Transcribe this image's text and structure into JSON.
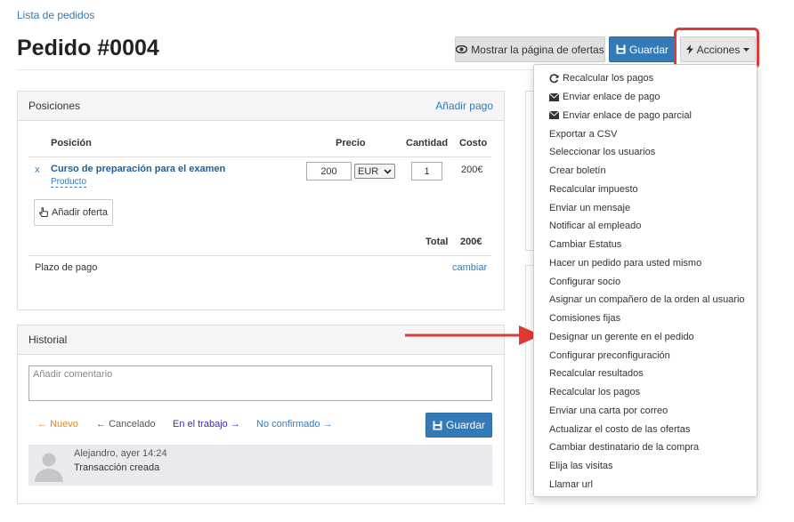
{
  "breadcrumb": "Lista de pedidos",
  "title": "Pedido #0004",
  "toolbar": {
    "show_offers": "Mostrar la página de ofertas",
    "save": "Guardar",
    "actions": "Acciones"
  },
  "positions": {
    "heading": "Posiciones",
    "add_payment": "Añadir pago",
    "columns": {
      "position": "Posición",
      "price": "Precio",
      "quantity": "Cantidad",
      "cost": "Costo"
    },
    "row": {
      "remove": "x",
      "name": "Curso de preparación para el examen",
      "type": "Producto",
      "price": "200",
      "currency": "EUR",
      "quantity": "1",
      "cost": "200€"
    },
    "add_offer": "Añadir oferta",
    "total_label": "Total",
    "total_value": "200€",
    "payment_term": "Plazo de pago",
    "change": "cambiar"
  },
  "history": {
    "heading": "Historial",
    "comment_placeholder": "Añadir comentario",
    "statuses": [
      {
        "label": "Nuevo",
        "color": "#e8832a"
      },
      {
        "label": "Cancelado",
        "color": "#555555"
      },
      {
        "label": "En el trabajo",
        "color": "#3a2fa8"
      },
      {
        "label": "No confirmado",
        "color": "#337ab7"
      }
    ],
    "save": "Guardar",
    "entry": {
      "meta": "Alejandro, ayer 14:24",
      "text": "Transacción creada"
    }
  },
  "actions_menu": [
    {
      "label": "Recalcular los pagos",
      "icon": "refresh-icon"
    },
    {
      "label": "Enviar enlace de pago",
      "icon": "envelope-icon"
    },
    {
      "label": "Enviar enlace de pago parcial",
      "icon": "envelope-icon"
    },
    {
      "label": "Exportar a CSV"
    },
    {
      "label": "Seleccionar los usuarios"
    },
    {
      "label": "Crear boletín"
    },
    {
      "label": "Recalcular impuesto"
    },
    {
      "label": "Enviar un mensaje"
    },
    {
      "label": "Notificar al empleado"
    },
    {
      "label": "Cambiar Estatus"
    },
    {
      "label": "Hacer un pedido para usted mismo"
    },
    {
      "label": "Configurar socio"
    },
    {
      "label": "Asignar un compañero de la orden al usuario"
    },
    {
      "label": "Comisiones fijas"
    },
    {
      "label": "Designar un gerente en el pedido"
    },
    {
      "label": "Configurar preconfiguración"
    },
    {
      "label": "Recalcular resultados"
    },
    {
      "label": "Recalcular los pagos"
    },
    {
      "label": "Enviar una carta por correo"
    },
    {
      "label": "Actualizar el costo de las ofertas"
    },
    {
      "label": "Cambiar destinatario de la compra"
    },
    {
      "label": "Elija las visitas"
    },
    {
      "label": "Llamar url"
    }
  ],
  "colors": {
    "primary": "#337ab7",
    "highlight": "#e03a36"
  }
}
